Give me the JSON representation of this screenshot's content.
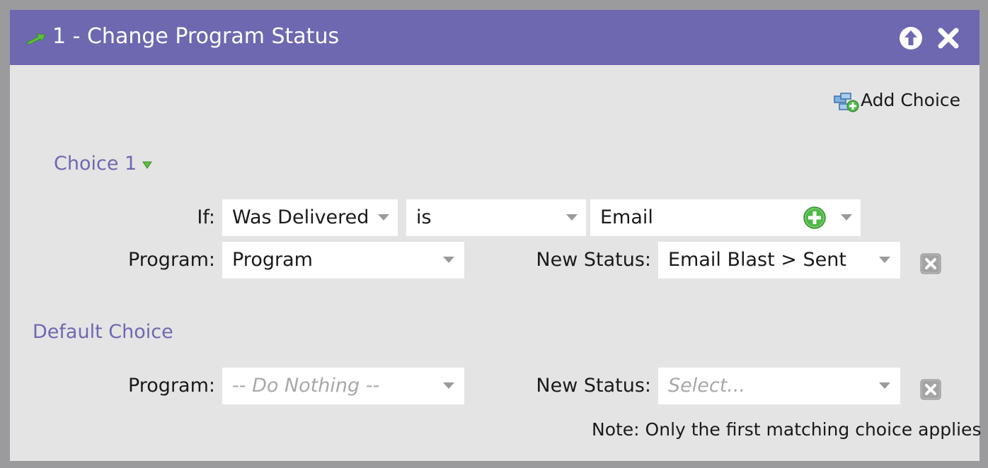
{
  "header": {
    "title": "1 - Change Program Status",
    "icons": [
      "arrow-icon",
      "collapse-up-icon",
      "close-icon"
    ]
  },
  "toolbar": {
    "add_choice_label": "Add Choice",
    "add_choice_icon": "add-choice-icon"
  },
  "choice1": {
    "title": "Choice 1",
    "if_label": "If:",
    "condition": "Was Delivered",
    "operator": "is",
    "value": "Email",
    "program_label": "Program:",
    "program": "Program",
    "new_status_label": "New Status:",
    "new_status": "Email Blast > Sent"
  },
  "default_choice": {
    "title": "Default Choice",
    "program_label": "Program:",
    "program": "-- Do Nothing --",
    "new_status_label": "New Status:",
    "new_status_placeholder": "Select..."
  },
  "note": "Note: Only the first matching choice applies",
  "colors": {
    "header": "#6e68b1",
    "accent_text": "#6e68b1",
    "panel": "#e4e4e4",
    "plus_green": "#4fb848"
  }
}
